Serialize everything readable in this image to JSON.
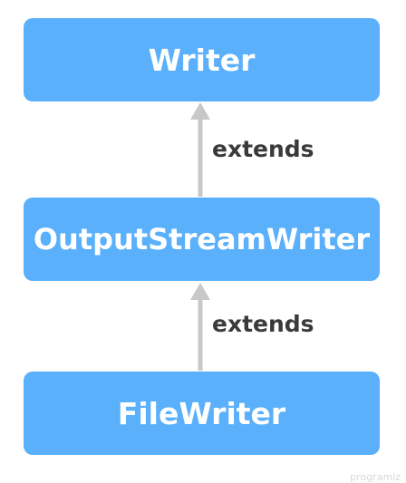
{
  "diagram": {
    "nodes": [
      {
        "id": "writer",
        "label": "Writer"
      },
      {
        "id": "output-stream-writer",
        "label": "OutputStreamWriter"
      },
      {
        "id": "file-writer",
        "label": "FileWriter"
      }
    ],
    "edges": [
      {
        "from": "output-stream-writer",
        "to": "writer",
        "label": "extends"
      },
      {
        "from": "file-writer",
        "to": "output-stream-writer",
        "label": "extends"
      }
    ]
  },
  "colors": {
    "node_fill": "#5ab0fa",
    "node_text": "#ffffff",
    "arrow": "#c8c8c8",
    "edge_label": "#3a3a3a"
  },
  "watermark": "programiz"
}
